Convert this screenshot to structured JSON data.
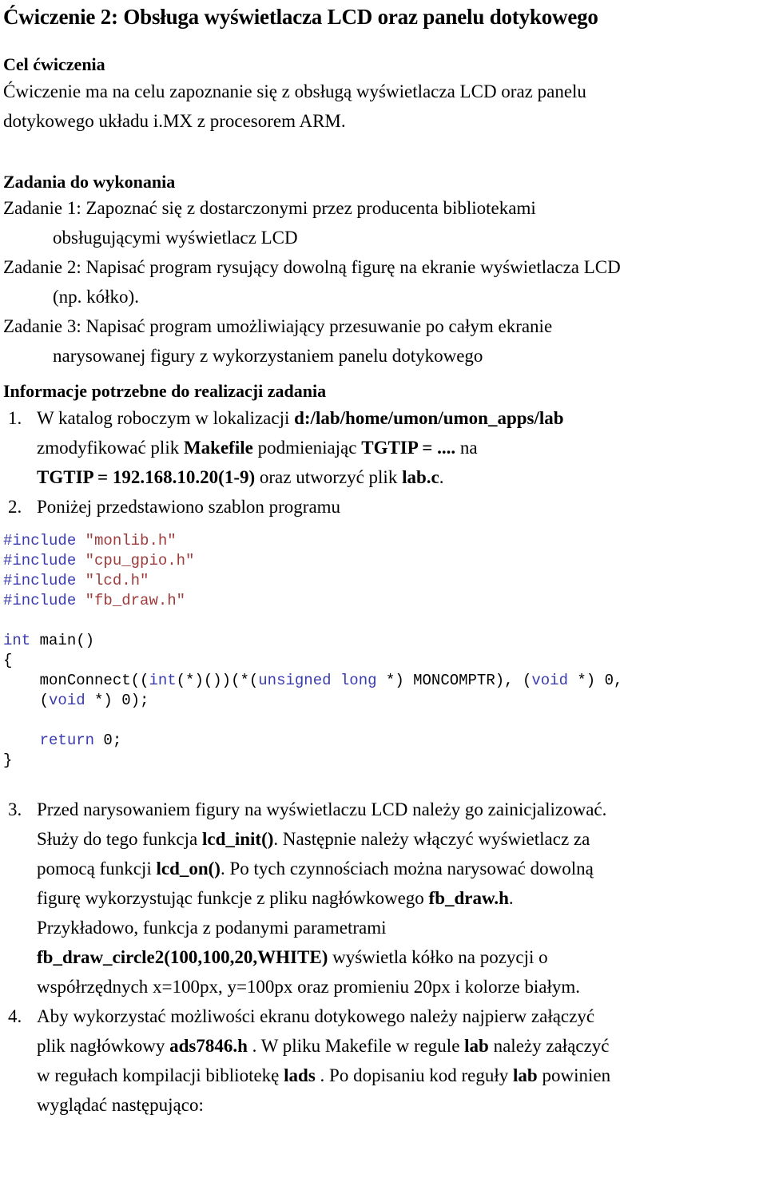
{
  "document": {
    "title": "Ćwiczenie 2: Obsługa wyświetlacza LCD oraz panelu dotykowego",
    "goal_heading": "Cel ćwiczenia",
    "goal_lines": [
      "Ćwiczenie ma na celu zapoznanie się z obsługą wyświetlacza LCD oraz panelu",
      "dotykowego układu  i.MX z procesorem ARM."
    ],
    "tasks_heading": "Zadania do wykonania",
    "tasks": [
      {
        "main": "Zadanie 1: Zapoznać się z dostarczonymi przez producenta bibliotekami",
        "cont": "obsługującymi wyświetlacz LCD"
      },
      {
        "main": "Zadanie 2: Napisać program rysujący dowolną figurę na ekranie wyświetlacza LCD",
        "cont": "(np. kółko)."
      },
      {
        "main": "Zadanie 3: Napisać program umożliwiający przesuwanie po całym ekranie",
        "cont": "narysowanej figury z wykorzystaniem panelu dotykowego"
      }
    ],
    "info_heading": "Informacje potrzebne do realizacji zadania",
    "info_items": [
      {
        "marker": "1.",
        "lines": [
          [
            {
              "t": "W katalog roboczym w lokalizacji ",
              "bold": false
            },
            {
              "t": "d:/lab/home/umon/umon_apps/lab",
              "bold": true
            }
          ],
          [
            {
              "t": "zmodyfikować plik ",
              "bold": false
            },
            {
              "t": "Makefile",
              "bold": true
            },
            {
              "t": " podmieniając ",
              "bold": false
            },
            {
              "t": "TGTIP = ....",
              "bold": true
            },
            {
              "t": " na",
              "bold": false
            }
          ],
          [
            {
              "t": "TGTIP = 192.168.10.20(1-9)",
              "bold": true
            },
            {
              "t": " oraz utworzyć plik ",
              "bold": false
            },
            {
              "t": "lab.c",
              "bold": true
            },
            {
              "t": ".",
              "bold": false
            }
          ]
        ]
      },
      {
        "marker": "2.",
        "lines": [
          [
            {
              "t": "Poniżej przedstawiono szablon programu",
              "bold": false
            }
          ]
        ]
      }
    ],
    "code_lines": [
      [
        {
          "t": "#include",
          "cls": "pp"
        },
        {
          "t": " ",
          "cls": ""
        },
        {
          "t": "\"monlib.h\"",
          "cls": "str"
        }
      ],
      [
        {
          "t": "#include",
          "cls": "pp"
        },
        {
          "t": " ",
          "cls": ""
        },
        {
          "t": "\"cpu_gpio.h\"",
          "cls": "str"
        }
      ],
      [
        {
          "t": "#include",
          "cls": "pp"
        },
        {
          "t": " ",
          "cls": ""
        },
        {
          "t": "\"lcd.h\"",
          "cls": "str"
        }
      ],
      [
        {
          "t": "#include",
          "cls": "pp"
        },
        {
          "t": " ",
          "cls": ""
        },
        {
          "t": "\"fb_draw.h\"",
          "cls": "str"
        }
      ],
      [],
      [
        {
          "t": "int",
          "cls": "kw"
        },
        {
          "t": " main()",
          "cls": ""
        }
      ],
      [
        {
          "t": "{",
          "cls": ""
        }
      ],
      [
        {
          "t": "    monConnect((",
          "cls": ""
        },
        {
          "t": "int",
          "cls": "kw"
        },
        {
          "t": "(*)())(*(",
          "cls": ""
        },
        {
          "t": "unsigned long",
          "cls": "kw"
        },
        {
          "t": " *) MONCOMPTR), (",
          "cls": ""
        },
        {
          "t": "void",
          "cls": "kw"
        },
        {
          "t": " *) 0,",
          "cls": ""
        }
      ],
      [
        {
          "t": "    (",
          "cls": ""
        },
        {
          "t": "void",
          "cls": "kw"
        },
        {
          "t": " *) 0);",
          "cls": ""
        }
      ],
      [],
      [
        {
          "t": "    ",
          "cls": ""
        },
        {
          "t": "return",
          "cls": "kw"
        },
        {
          "t": " 0;",
          "cls": ""
        }
      ],
      [
        {
          "t": "}",
          "cls": ""
        }
      ]
    ],
    "info_items_2": [
      {
        "marker": "3.",
        "lines": [
          [
            {
              "t": "Przed narysowaniem figury na wyświetlaczu LCD należy go zainicjalizować.",
              "bold": false
            }
          ],
          [
            {
              "t": "Służy do tego funkcja ",
              "bold": false
            },
            {
              "t": "lcd_init()",
              "bold": true
            },
            {
              "t": ". Następnie należy włączyć wyświetlacz za",
              "bold": false
            }
          ],
          [
            {
              "t": "pomocą funkcji ",
              "bold": false
            },
            {
              "t": "lcd_on()",
              "bold": true
            },
            {
              "t": ". Po tych czynnościach można narysować dowolną",
              "bold": false
            }
          ],
          [
            {
              "t": "figurę wykorzystując funkcje z pliku nagłówkowego ",
              "bold": false
            },
            {
              "t": "fb_draw.h",
              "bold": true
            },
            {
              "t": ".",
              "bold": false
            }
          ],
          [
            {
              "t": "Przykładowo, funkcja  z podanymi parametrami",
              "bold": false
            }
          ],
          [
            {
              "t": "fb_draw_circle2(100,100,20,WHITE)",
              "bold": true
            },
            {
              "t": " wyświetla kółko na pozycji o",
              "bold": false
            }
          ],
          [
            {
              "t": "współrzędnych x=100px, y=100px oraz promieniu 20px i kolorze białym.",
              "bold": false
            }
          ]
        ]
      },
      {
        "marker": "4.",
        "lines": [
          [
            {
              "t": "Aby wykorzystać możliwości ekranu dotykowego należy najpierw załączyć",
              "bold": false
            }
          ],
          [
            {
              "t": "plik nagłówkowy  ",
              "bold": false
            },
            {
              "t": "ads7846.h",
              "bold": true
            },
            {
              "t": " . W pliku Makefile w regule ",
              "bold": false
            },
            {
              "t": "lab",
              "bold": true
            },
            {
              "t": " należy załączyć",
              "bold": false
            }
          ],
          [
            {
              "t": "w regułach kompilacji bibliotekę ",
              "bold": false
            },
            {
              "t": "lads",
              "bold": true
            },
            {
              "t": " . Po dopisaniu kod reguły ",
              "bold": false
            },
            {
              "t": "lab",
              "bold": true
            },
            {
              "t": " powinien",
              "bold": false
            }
          ],
          [
            {
              "t": "wyglądać następująco:",
              "bold": false
            }
          ]
        ]
      }
    ]
  },
  "colors": {
    "text": "#000000",
    "code_keyword": "#3b3bb0",
    "code_string": "#9e3b3b",
    "background": "#ffffff"
  }
}
